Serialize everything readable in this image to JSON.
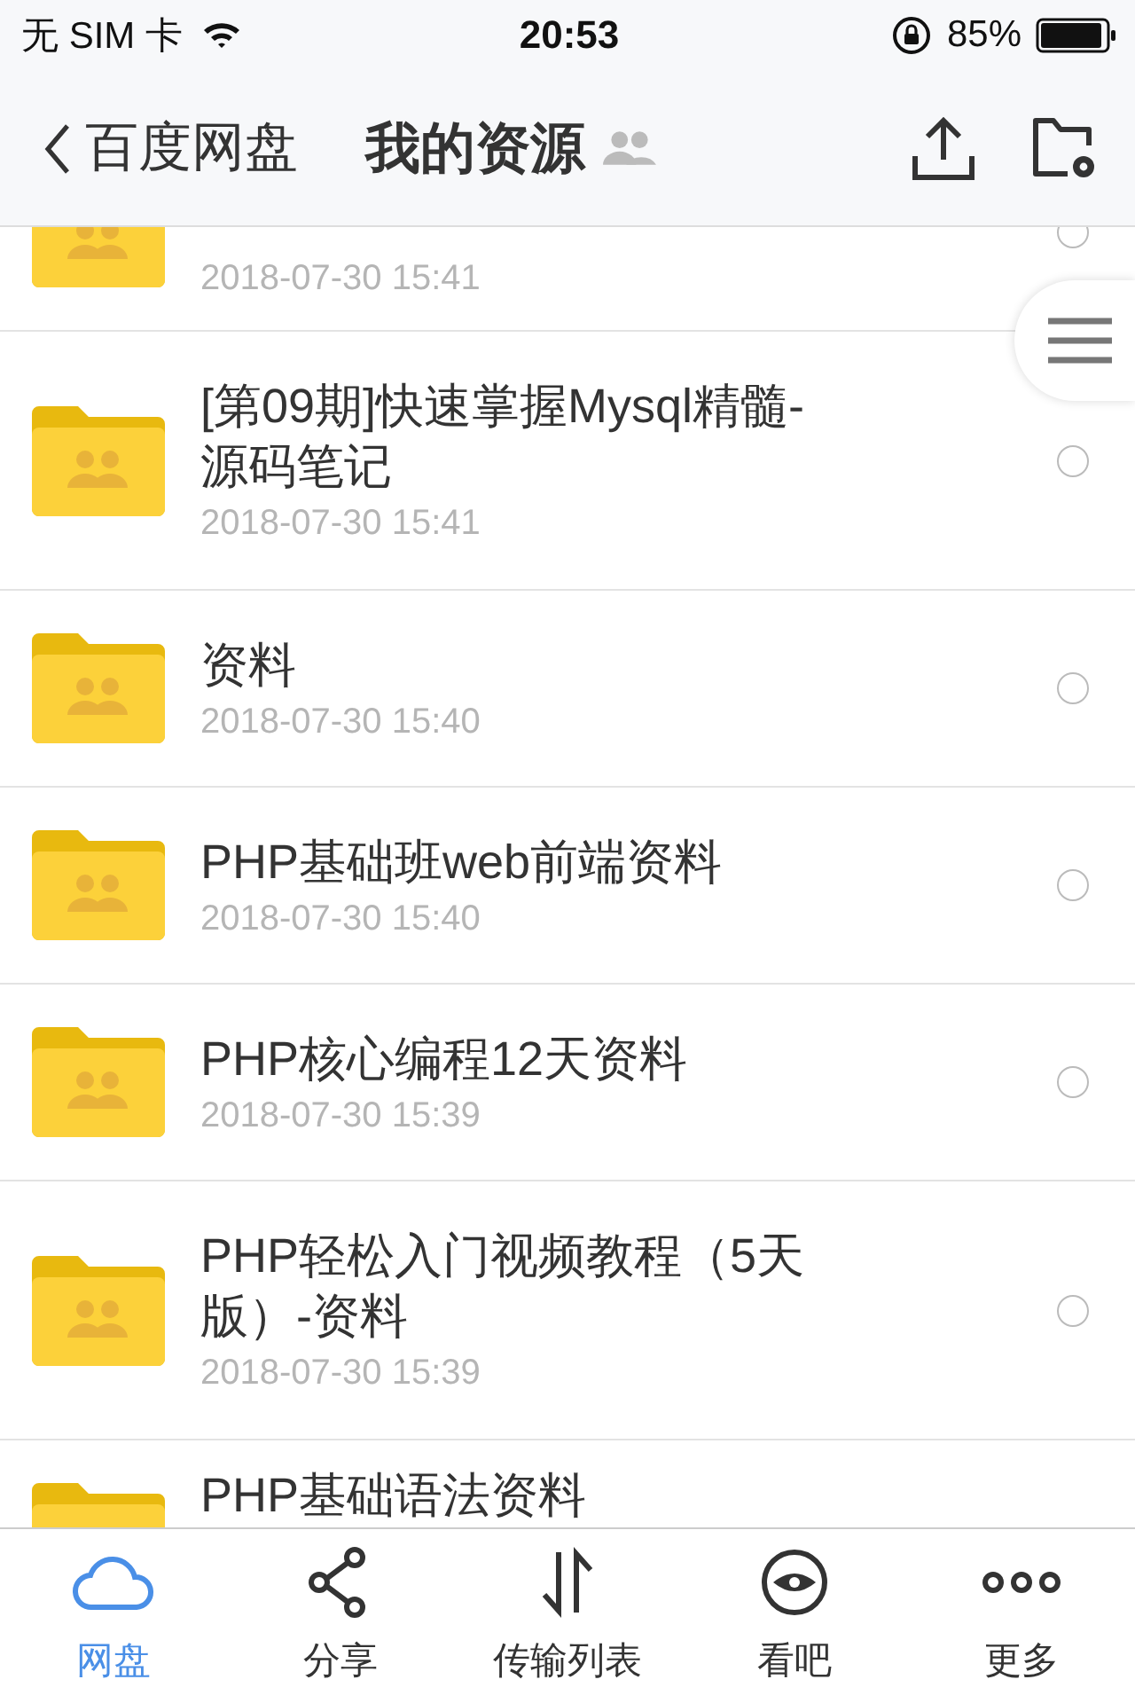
{
  "status_bar": {
    "carrier": "无 SIM 卡",
    "time": "20:53",
    "battery": "85%"
  },
  "nav": {
    "back": "百度网盘",
    "title": "我的资源"
  },
  "files": [
    {
      "date": "2018-07-30 15:41",
      "selected": false
    },
    {
      "title": "[第09期]快速掌握Mysql精髓-源码笔记",
      "date": "2018-07-30 15:41",
      "selected": false
    },
    {
      "title": "资料",
      "date": "2018-07-30 15:40",
      "selected": false
    },
    {
      "title": "PHP基础班web前端资料",
      "date": "2018-07-30 15:40",
      "selected": false
    },
    {
      "title": "PHP核心编程12天资料",
      "date": "2018-07-30 15:39",
      "selected": false
    },
    {
      "title": "PHP轻松入门视频教程（5天版）-资料",
      "date": "2018-07-30 15:39",
      "selected": false
    },
    {
      "title": "PHP基础语法资料"
    }
  ],
  "tabs": [
    {
      "label": "网盘",
      "selected": true
    },
    {
      "label": "分享",
      "selected": false
    },
    {
      "label": "传输列表",
      "selected": false
    },
    {
      "label": "看吧",
      "selected": false
    },
    {
      "label": "更多",
      "selected": false
    }
  ]
}
